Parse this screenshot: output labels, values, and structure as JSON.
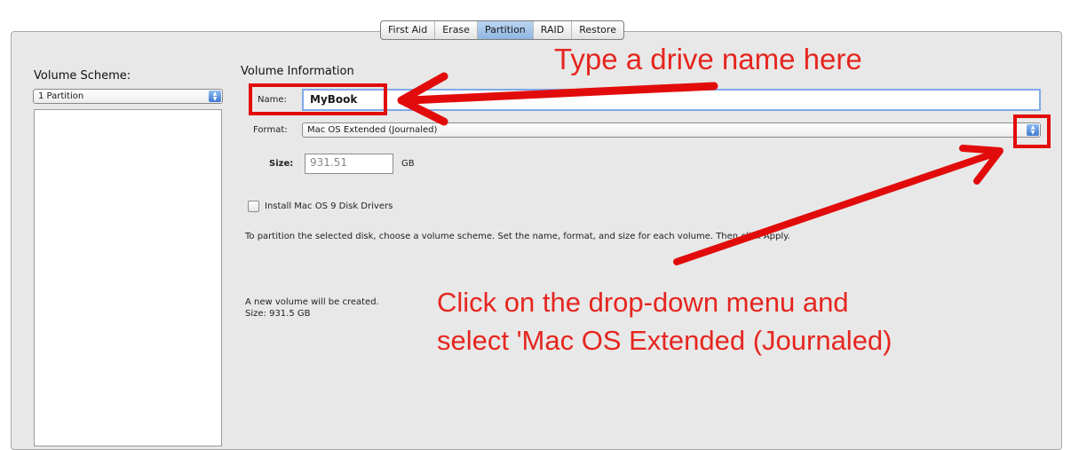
{
  "tabs": [
    "First Aid",
    "Erase",
    "Partition",
    "RAID",
    "Restore"
  ],
  "active_tab": "Partition",
  "volume_scheme": {
    "label": "Volume Scheme:",
    "selected": "1 Partition"
  },
  "volume_info": {
    "heading": "Volume Information",
    "name_label": "Name:",
    "name_value": "MyBook",
    "format_label": "Format:",
    "format_value": "Mac OS Extended (Journaled)",
    "size_label": "Size:",
    "size_value": "931.51",
    "size_unit": "GB"
  },
  "install_drivers_label": "Install Mac OS 9 Disk Drivers",
  "instructions": "To partition the selected disk, choose a volume scheme. Set the name, format, and size for each volume. Then click Apply.",
  "new_volume": {
    "line1": "A new volume will be created.",
    "line2": "Size: 931.5 GB"
  },
  "annotations": {
    "top": "Type a drive name here",
    "bottom_line1": "Click on the drop-down menu and",
    "bottom_line2": "select 'Mac OS Extended (Journaled)",
    "color": "#e5261f"
  },
  "icons": {
    "popup_arrows": "updown-arrows-icon"
  }
}
